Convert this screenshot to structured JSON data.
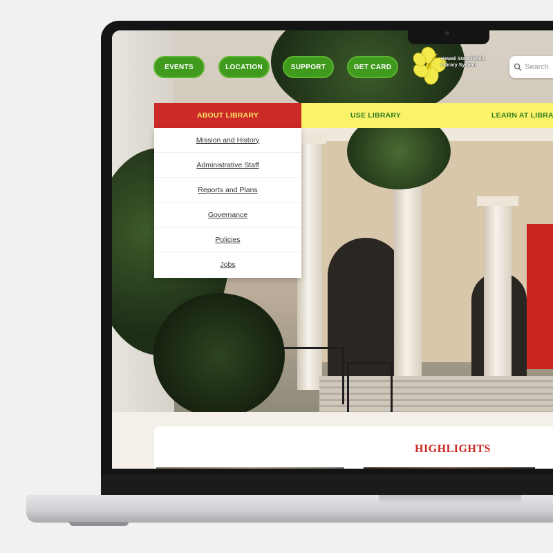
{
  "site": {
    "logo_text": "Hawaii State Public Library System"
  },
  "header": {
    "nav_pills": [
      {
        "label": "EVENTS"
      },
      {
        "label": "LOCATION"
      },
      {
        "label": "SUPPORT"
      },
      {
        "label": "GET CARD"
      }
    ],
    "search": {
      "placeholder": "Search"
    }
  },
  "main_menu": {
    "tabs": [
      {
        "label": "ABOUT LIBRARY",
        "active": true
      },
      {
        "label": "USE LIBRARY"
      },
      {
        "label": "LEARN AT LIBRARY"
      }
    ],
    "about_dropdown": [
      {
        "label": "Mission and History"
      },
      {
        "label": "Administrative Staff"
      },
      {
        "label": "Reports and Plans"
      },
      {
        "label": "Governance"
      },
      {
        "label": "Policies"
      },
      {
        "label": "Jobs"
      }
    ]
  },
  "highlights": {
    "title": "HIGHLIGHTS"
  },
  "colors": {
    "pill_green": "#3f9a1e",
    "menu_red": "#cc2a26",
    "menu_yellow": "#fbf26a",
    "menu_green_text": "#2f7e1c",
    "highlight_red": "#c8261f",
    "logo_yellow": "#f2e94a"
  },
  "icons": {
    "logo": "hibiscus-flower-icon",
    "search": "magnifier-icon"
  }
}
